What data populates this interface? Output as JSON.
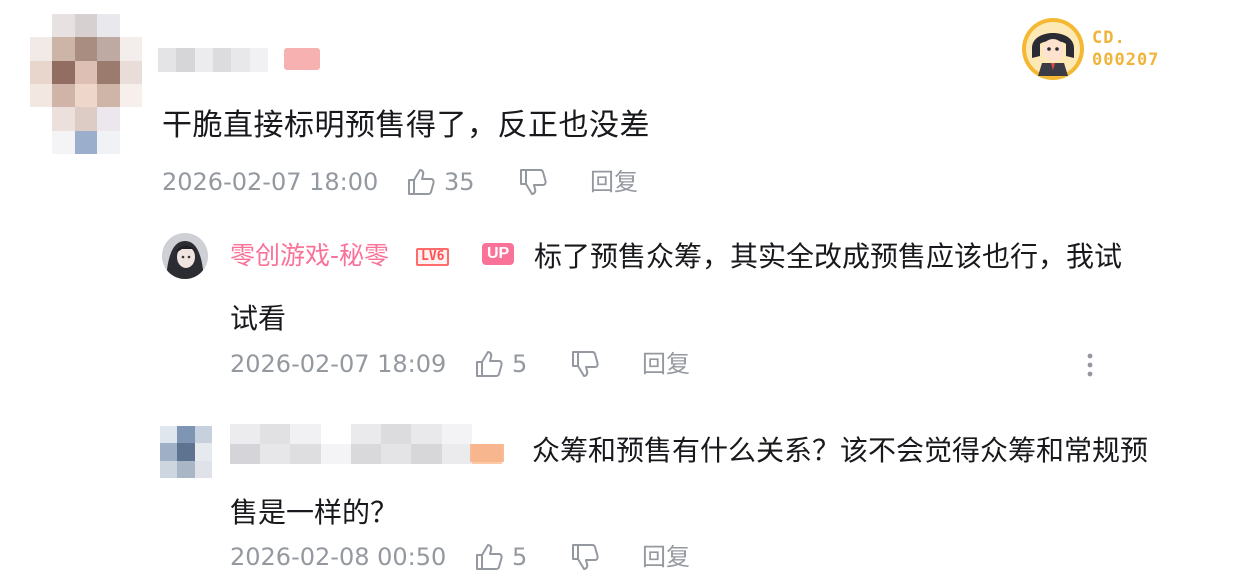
{
  "top_comment": {
    "text": "干脆直接标明预售得了，反正也没差",
    "time": "2026-02-07 18:00",
    "like_count": "35",
    "reply_label": "回复"
  },
  "corner_badge": {
    "line1": "CD.",
    "line2": "000207"
  },
  "replies": [
    {
      "username": "零创游戏-秘零",
      "level_badge": "LV6",
      "up_badge": "UP",
      "text_line1": "标了预售众筹，其实全改成预售应该也行，我试",
      "text_line2": "试看",
      "time": "2026-02-07 18:09",
      "like_count": "5",
      "reply_label": "回复",
      "more_glyph": "⋮"
    },
    {
      "text_line1": "众筹和预售有什么关系？该不会觉得众筹和常规预",
      "text_line2": "售是一样的？",
      "time": "2026-02-08 00:50",
      "like_count": "5",
      "reply_label": "回复"
    }
  ],
  "colors": {
    "username_pink": "#fb7299",
    "meta_gray": "#9499a0",
    "text_dark": "#18191c",
    "badge_gold": "#f5b833"
  },
  "icons": [
    "thumbs-up-icon",
    "thumbs-down-icon",
    "more-vertical-icon"
  ]
}
